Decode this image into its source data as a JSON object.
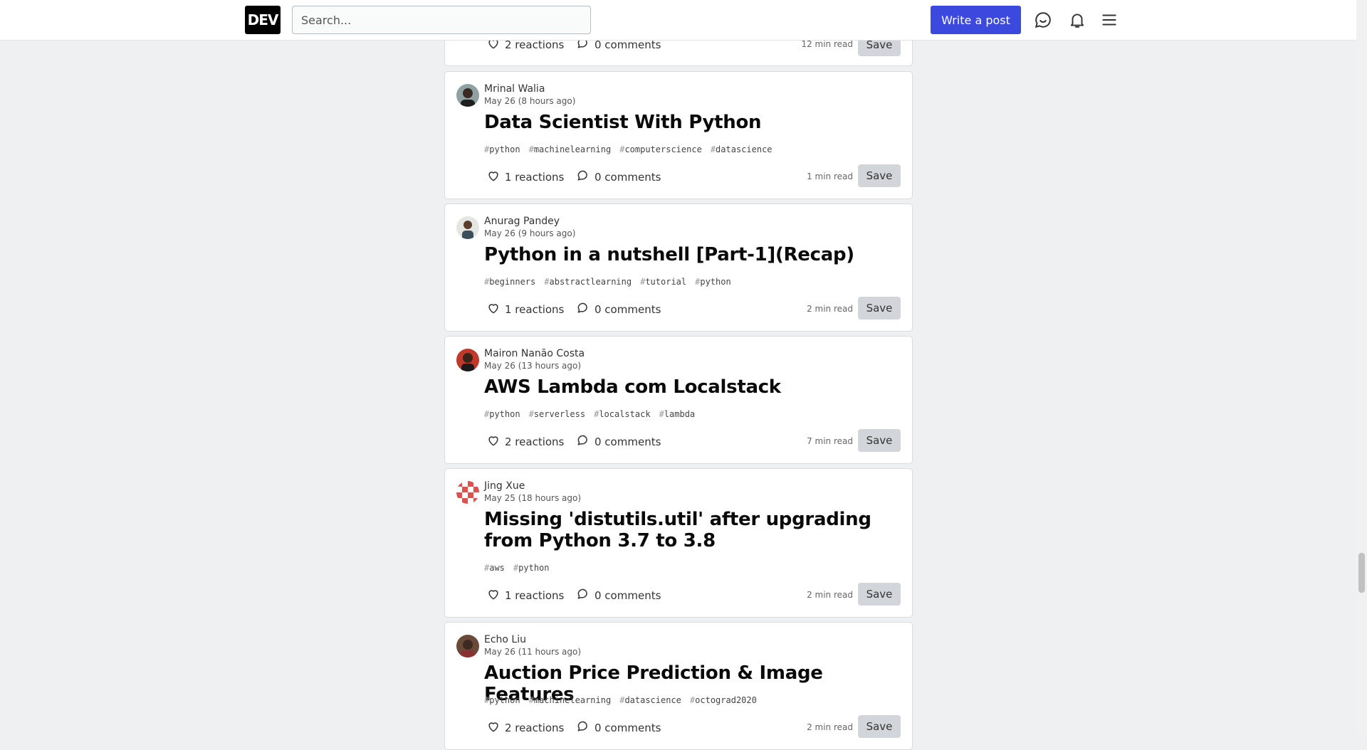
{
  "header": {
    "logo_text": "DEV",
    "search_placeholder": "Search...",
    "write_button": "Write a post",
    "icons": [
      "chat-icon",
      "bell-icon",
      "menu-icon"
    ],
    "accent_color": "#3b49df"
  },
  "feed": {
    "top_partial": {
      "reactions": "2 reactions",
      "comments": "0 comments",
      "read_time": "12 min read",
      "save": "Save"
    },
    "posts": [
      {
        "author": "Mrinal Walia",
        "date": "May 26 (8 hours ago)",
        "title": "Data Scientist With Python",
        "tags": [
          "python",
          "machinelearning",
          "computerscience",
          "datascience"
        ],
        "reactions": "1 reactions",
        "comments": "0 comments",
        "read_time": "1 min read",
        "save": "Save"
      },
      {
        "author": "Anurag Pandey",
        "date": "May 26 (9 hours ago)",
        "title": "Python in a nutshell [Part-1](Recap)",
        "tags": [
          "beginners",
          "abstractlearning",
          "tutorial",
          "python"
        ],
        "reactions": "1 reactions",
        "comments": "0 comments",
        "read_time": "2 min read",
        "save": "Save"
      },
      {
        "author": "Mairon Nanão Costa",
        "date": "May 26 (13 hours ago)",
        "title": "AWS Lambda com Localstack",
        "tags": [
          "python",
          "serverless",
          "localstack",
          "lambda"
        ],
        "reactions": "2 reactions",
        "comments": "0 comments",
        "read_time": "7 min read",
        "save": "Save"
      },
      {
        "author": "Jing Xue",
        "date": "May 25 (18 hours ago)",
        "title": "Missing 'distutils.util' after upgrading from Python 3.7 to 3.8",
        "tags": [
          "aws",
          "python"
        ],
        "reactions": "1 reactions",
        "comments": "0 comments",
        "read_time": "2 min read",
        "save": "Save"
      },
      {
        "author": "Echo Liu",
        "date": "May 26 (11 hours ago)",
        "title": "Auction Price Prediction & Image Features",
        "tags": [
          "python",
          "machinelearning",
          "datascience",
          "octograd2020"
        ],
        "reactions": "2 reactions",
        "comments": "0 comments",
        "read_time": "2 min read",
        "save": "Save"
      }
    ]
  }
}
